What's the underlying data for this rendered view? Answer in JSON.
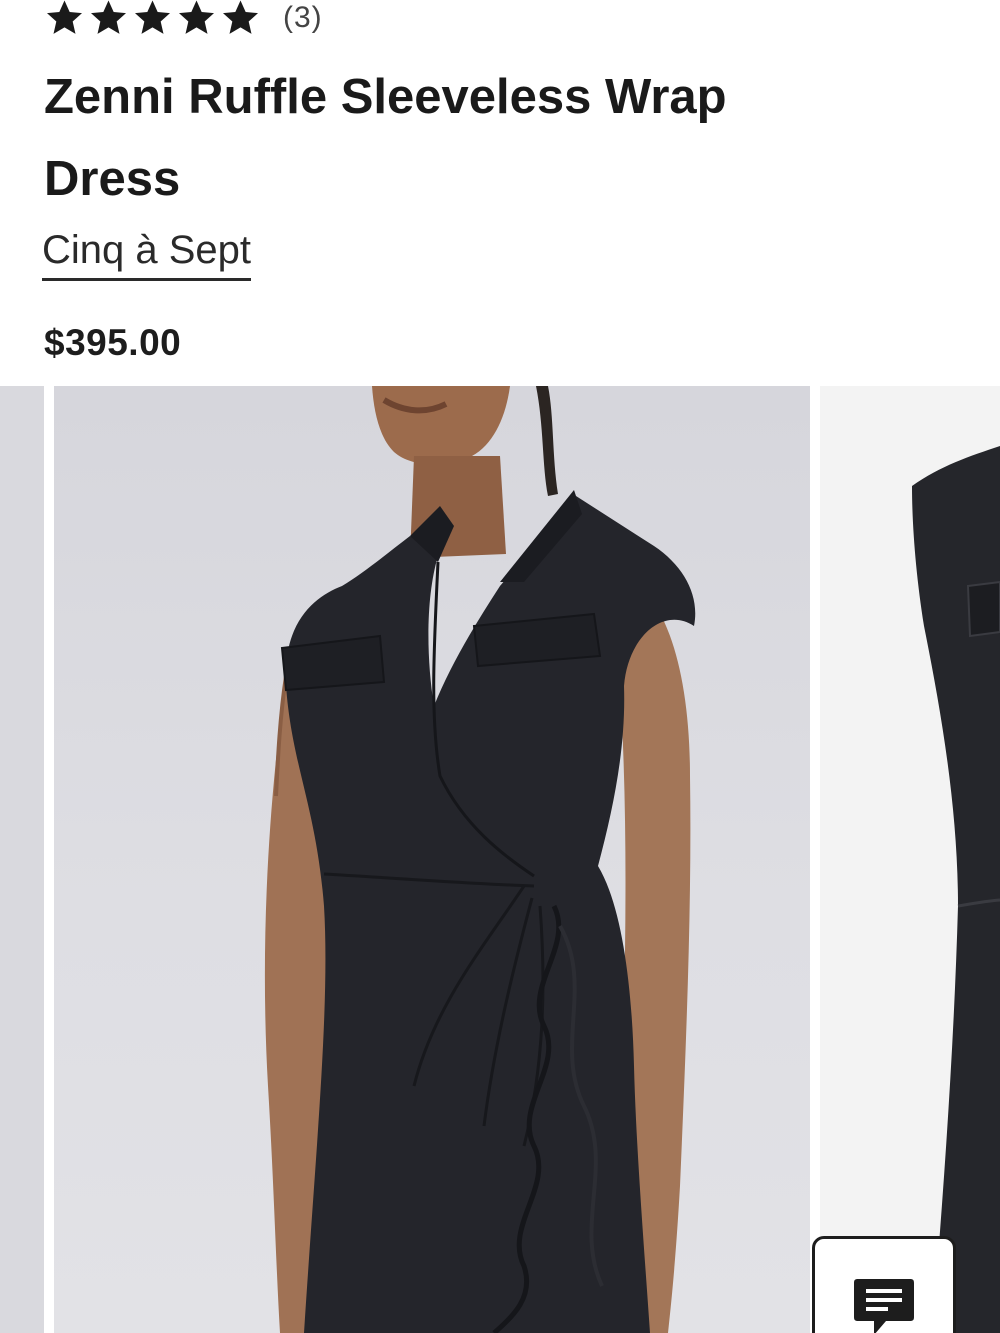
{
  "product": {
    "rating": 5,
    "rating_max": 5,
    "review_count": "(3)",
    "title": "Zenni Ruffle Sleeveless Wrap Dress",
    "brand": "Cinq à Sept",
    "price": "$395.00"
  },
  "icons": {
    "star": "star-icon",
    "chat": "chat-icon"
  },
  "colors": {
    "text": "#1d1d1d",
    "star": "#1a1a1a",
    "dress": "#24252b"
  }
}
